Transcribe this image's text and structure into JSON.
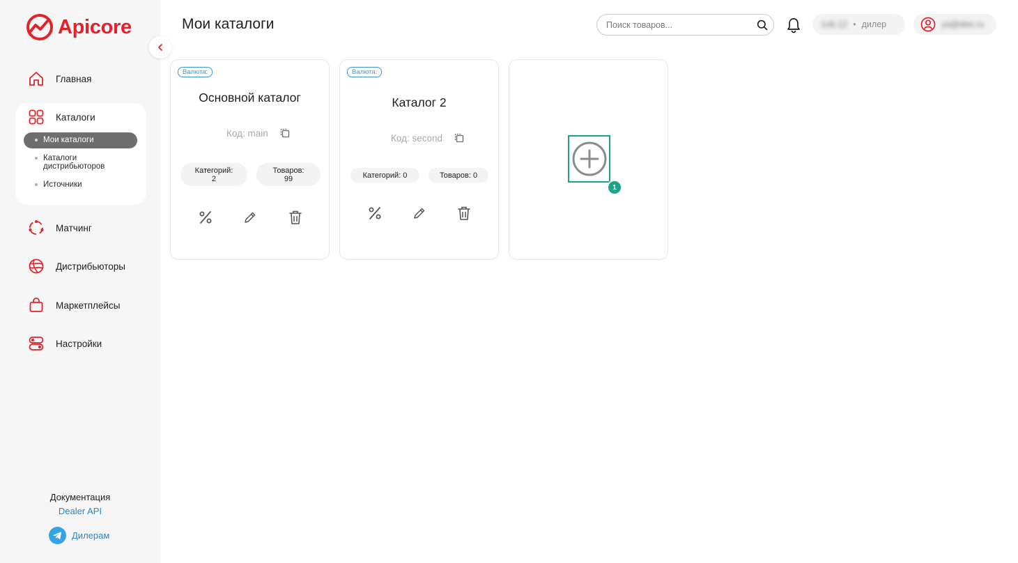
{
  "brand": {
    "name": "Apicore",
    "color": "#e3222b"
  },
  "sidebar": {
    "items": [
      {
        "label": "Главная",
        "icon": "home-icon"
      },
      {
        "label": "Каталоги",
        "icon": "grid-icon"
      },
      {
        "label": "Матчинг",
        "icon": "matching-icon"
      },
      {
        "label": "Дистрибьюторы",
        "icon": "globe-icon"
      },
      {
        "label": "Маркетплейсы",
        "icon": "bag-icon"
      },
      {
        "label": "Настройки",
        "icon": "toggles-icon"
      }
    ],
    "catalog_sub": [
      {
        "label": "Мои каталоги",
        "active": true
      },
      {
        "label_line1": "Каталоги",
        "label_line2": "дистрибьюторов"
      },
      {
        "label": "Источники"
      }
    ],
    "footer": {
      "doc_label": "Документация",
      "doc_link": "Dealer API",
      "telegram": "Дилерам"
    }
  },
  "header": {
    "title": "Мои каталоги",
    "search_placeholder": "Поиск товаров...",
    "dealer_pill": {
      "name": "1ob.12",
      "role": "дилер"
    },
    "user_pill": {
      "email": "ya@dee.ru"
    }
  },
  "cards": [
    {
      "badge": "Валюта:",
      "title": "Основной каталог",
      "code": "Код: main",
      "categories_label": "Категорий:",
      "categories_value": "2",
      "products_label": "Товаров:",
      "products_value": "99"
    },
    {
      "badge": "Валюта:",
      "title": "Каталог 2",
      "code": "Код: second",
      "categories": "Категорий: 0",
      "products": "Товаров: 0"
    }
  ],
  "add_card": {
    "marker": "1"
  },
  "colors": {
    "accent_red": "#e3222b",
    "link_blue": "#2c87c8",
    "marker_green": "#1aa48a"
  }
}
